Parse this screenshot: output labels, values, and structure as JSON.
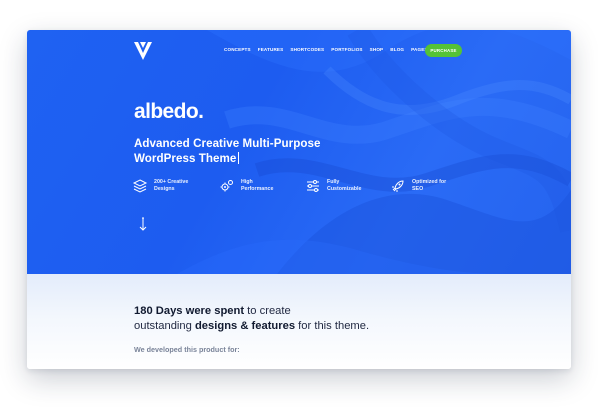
{
  "nav": {
    "items": [
      "CONCEPTS",
      "FEATURES",
      "SHORTCODES",
      "PORTFOLIOS",
      "SHOP",
      "BLOG",
      "PAGES"
    ],
    "purchase_label": "PURCHASE"
  },
  "hero": {
    "brand": "albedo.",
    "headline_line1": "Advanced Creative Multi-Purpose",
    "headline_line2": "WordPress Theme",
    "features": [
      {
        "icon": "layers-icon",
        "line1": "200+ Creative",
        "line2": "Designs"
      },
      {
        "icon": "gears-icon",
        "line1": "High",
        "line2": "Performance"
      },
      {
        "icon": "sliders-icon",
        "line1": "Fully",
        "line2": "Customizable"
      },
      {
        "icon": "rocket-icon",
        "line1": "Optimized for",
        "line2": "SEO"
      }
    ]
  },
  "content": {
    "intro_bold1": "180 Days were spent",
    "intro_text1": " to create",
    "intro_text2": "outstanding ",
    "intro_bold2": "designs & features",
    "intro_text3": " for this theme.",
    "developed_for": "We developed this product for:"
  },
  "colors": {
    "hero_blue": "#1f62f2",
    "purchase_green": "#55c236",
    "text_dark": "#1f2740",
    "muted": "#7a8499"
  }
}
